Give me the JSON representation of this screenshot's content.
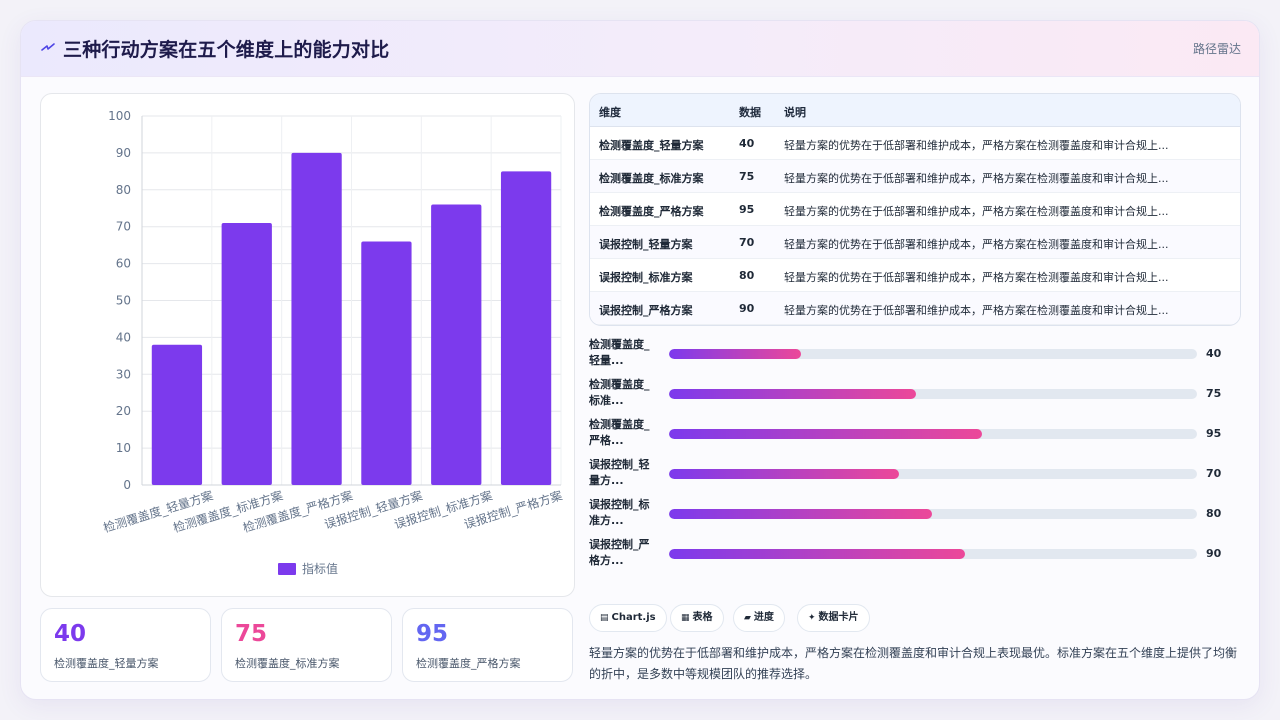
{
  "header": {
    "title": "三种行动方案在五个维度上的能力对比",
    "subtitle": "路径雷达"
  },
  "colors": {
    "accent": "#7c3aed",
    "pink": "#ec4899",
    "indigo": "#6366f1"
  },
  "chart_data": {
    "type": "bar",
    "categories": [
      "检测覆盖度_轻量方案",
      "检测覆盖度_标准方案",
      "检测覆盖度_严格方案",
      "误报控制_轻量方案",
      "误报控制_标准方案",
      "误报控制_严格方案"
    ],
    "series": [
      {
        "name": "指标值",
        "values": [
          38,
          71,
          90,
          66,
          76,
          85
        ]
      }
    ],
    "ylim": [
      0,
      100
    ],
    "yticks": [
      0,
      10,
      20,
      30,
      40,
      50,
      60,
      70,
      80,
      90,
      100
    ],
    "grid": true,
    "legend": "bottom",
    "color": "#7c3aed"
  },
  "stats": [
    {
      "value": "40",
      "label": "检测覆盖度_轻量方案",
      "color": "#7c3aed"
    },
    {
      "value": "75",
      "label": "检测覆盖度_标准方案",
      "color": "#ec4899"
    },
    {
      "value": "95",
      "label": "检测覆盖度_严格方案",
      "color": "#6366f1"
    }
  ],
  "table": {
    "headers": [
      "维度",
      "数据",
      "说明"
    ],
    "rows": [
      [
        "检测覆盖度_轻量方案",
        "40",
        "轻量方案的优势在于低部署和维护成本，严格方案在检测覆盖度和审计合规上..."
      ],
      [
        "检测覆盖度_标准方案",
        "75",
        "轻量方案的优势在于低部署和维护成本，严格方案在检测覆盖度和审计合规上..."
      ],
      [
        "检测覆盖度_严格方案",
        "95",
        "轻量方案的优势在于低部署和维护成本，严格方案在检测覆盖度和审计合规上..."
      ],
      [
        "误报控制_轻量方案",
        "70",
        "轻量方案的优势在于低部署和维护成本，严格方案在检测覆盖度和审计合规上..."
      ],
      [
        "误报控制_标准方案",
        "80",
        "轻量方案的优势在于低部署和维护成本，严格方案在检测覆盖度和审计合规上..."
      ],
      [
        "误报控制_严格方案",
        "90",
        "轻量方案的优势在于低部署和维护成本，严格方案在检测覆盖度和审计合规上..."
      ]
    ]
  },
  "progress": [
    {
      "line1": "检测覆盖度_",
      "line2": "轻量...",
      "value": "40",
      "fraction": 0.25
    },
    {
      "line1": "检测覆盖度_",
      "line2": "标准...",
      "value": "75",
      "fraction": 0.467
    },
    {
      "line1": "检测覆盖度_",
      "line2": "严格...",
      "value": "95",
      "fraction": 0.592
    },
    {
      "line1": "误报控制_轻",
      "line2": "量方...",
      "value": "70",
      "fraction": 0.436
    },
    {
      "line1": "误报控制_标",
      "line2": "准方...",
      "value": "80",
      "fraction": 0.498
    },
    {
      "line1": "误报控制_严",
      "line2": "格方...",
      "value": "90",
      "fraction": 0.56
    }
  ],
  "chips": [
    {
      "icon": "▤",
      "label": "Chart.js",
      "icon_name": "chart-icon"
    },
    {
      "icon": "▦",
      "label": "表格",
      "icon_name": "table-icon"
    },
    {
      "icon": "▰",
      "label": "进度",
      "icon_name": "progress-icon"
    },
    {
      "icon": "✦",
      "label": "数据卡片",
      "icon_name": "sparkle-icon"
    }
  ],
  "summary": "轻量方案的优势在于低部署和维护成本，严格方案在检测覆盖度和审计合规上表现最优。标准方案在五个维度上提供了均衡的折中，是多数中等规模团队的推荐选择。"
}
